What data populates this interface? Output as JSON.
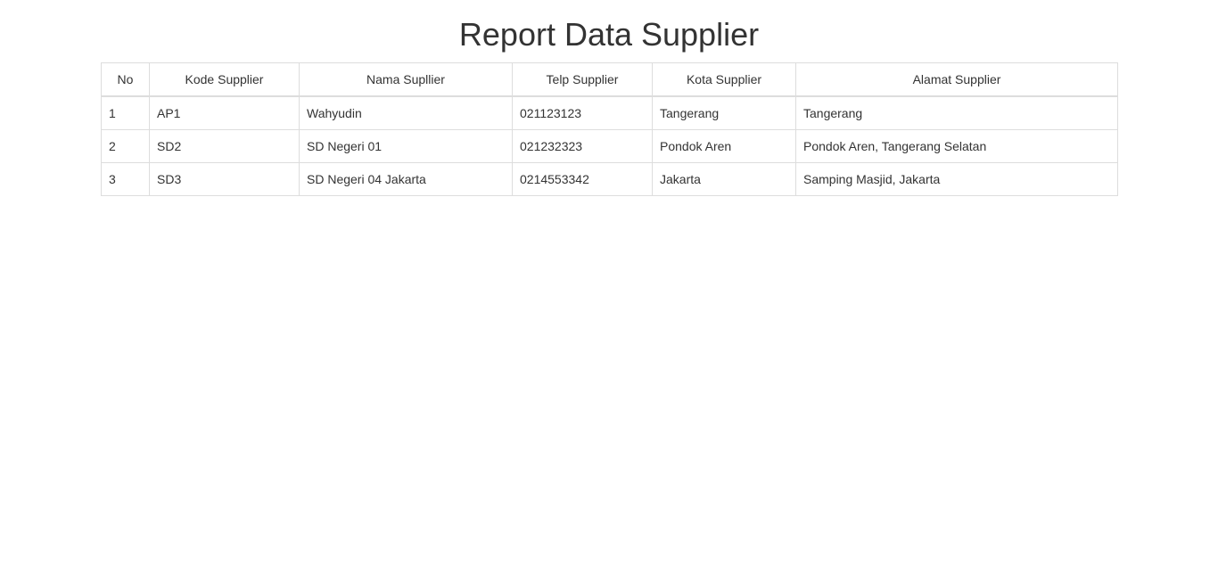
{
  "page": {
    "title": "Report Data Supplier"
  },
  "table": {
    "headers": [
      "No",
      "Kode Supplier",
      "Nama Supllier",
      "Telp Supplier",
      "Kota Supplier",
      "Alamat Supplier"
    ],
    "rows": [
      [
        "1",
        "AP1",
        "Wahyudin",
        "021123123",
        "Tangerang",
        "Tangerang"
      ],
      [
        "2",
        "SD2",
        "SD Negeri 01",
        "021232323",
        "Pondok Aren",
        "Pondok Aren, Tangerang Selatan"
      ],
      [
        "3",
        "SD3",
        "SD Negeri 04 Jakarta",
        "0214553342",
        "Jakarta",
        "Samping Masjid, Jakarta"
      ]
    ]
  },
  "colors": {
    "text": "#333333",
    "border": "#dddddd",
    "background": "#ffffff"
  }
}
